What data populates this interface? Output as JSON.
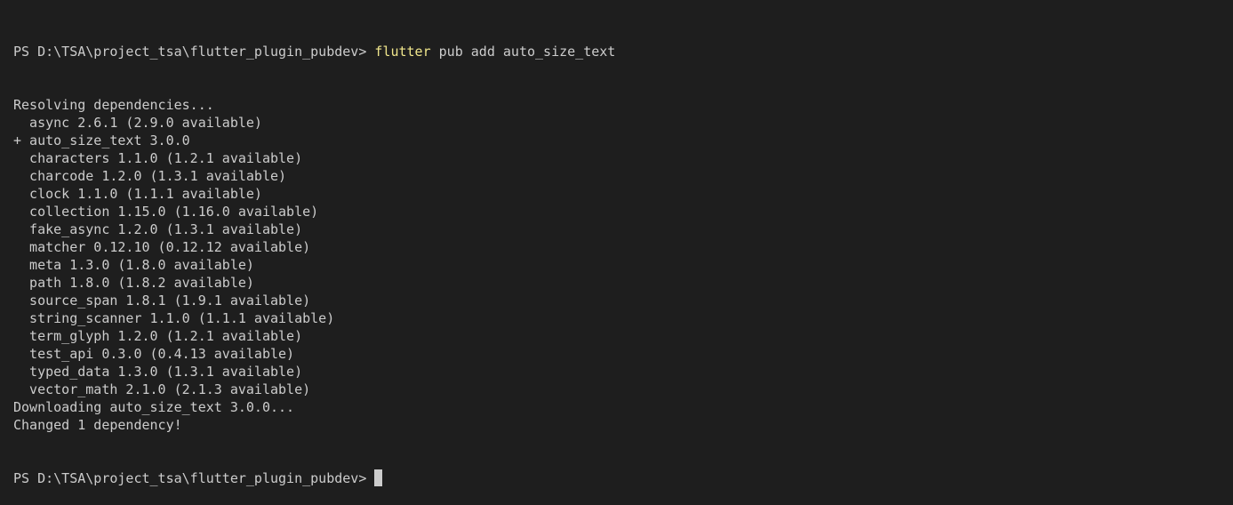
{
  "terminal": {
    "prompt": "PS D:\\TSA\\project_tsa\\flutter_plugin_pubdev> ",
    "command": {
      "program": "flutter",
      "args": " pub add auto_size_text"
    },
    "output": [
      "Resolving dependencies...",
      "  async 2.6.1 (2.9.0 available)",
      "+ auto_size_text 3.0.0",
      "  characters 1.1.0 (1.2.1 available)",
      "  charcode 1.2.0 (1.3.1 available)",
      "  clock 1.1.0 (1.1.1 available)",
      "  collection 1.15.0 (1.16.0 available)",
      "  fake_async 1.2.0 (1.3.1 available)",
      "  matcher 0.12.10 (0.12.12 available)",
      "  meta 1.3.0 (1.8.0 available)",
      "  path 1.8.0 (1.8.2 available)",
      "  source_span 1.8.1 (1.9.1 available)",
      "  string_scanner 1.1.0 (1.1.1 available)",
      "  term_glyph 1.2.0 (1.2.1 available)",
      "  test_api 0.3.0 (0.4.13 available)",
      "  typed_data 1.3.0 (1.3.1 available)",
      "  vector_math 2.1.0 (2.1.3 available)",
      "Downloading auto_size_text 3.0.0...",
      "Changed 1 dependency!"
    ],
    "final_prompt": "PS D:\\TSA\\project_tsa\\flutter_plugin_pubdev> "
  },
  "colors": {
    "background": "#1e1e1e",
    "text": "#cccccc",
    "command_highlight": "#f0e68c"
  }
}
